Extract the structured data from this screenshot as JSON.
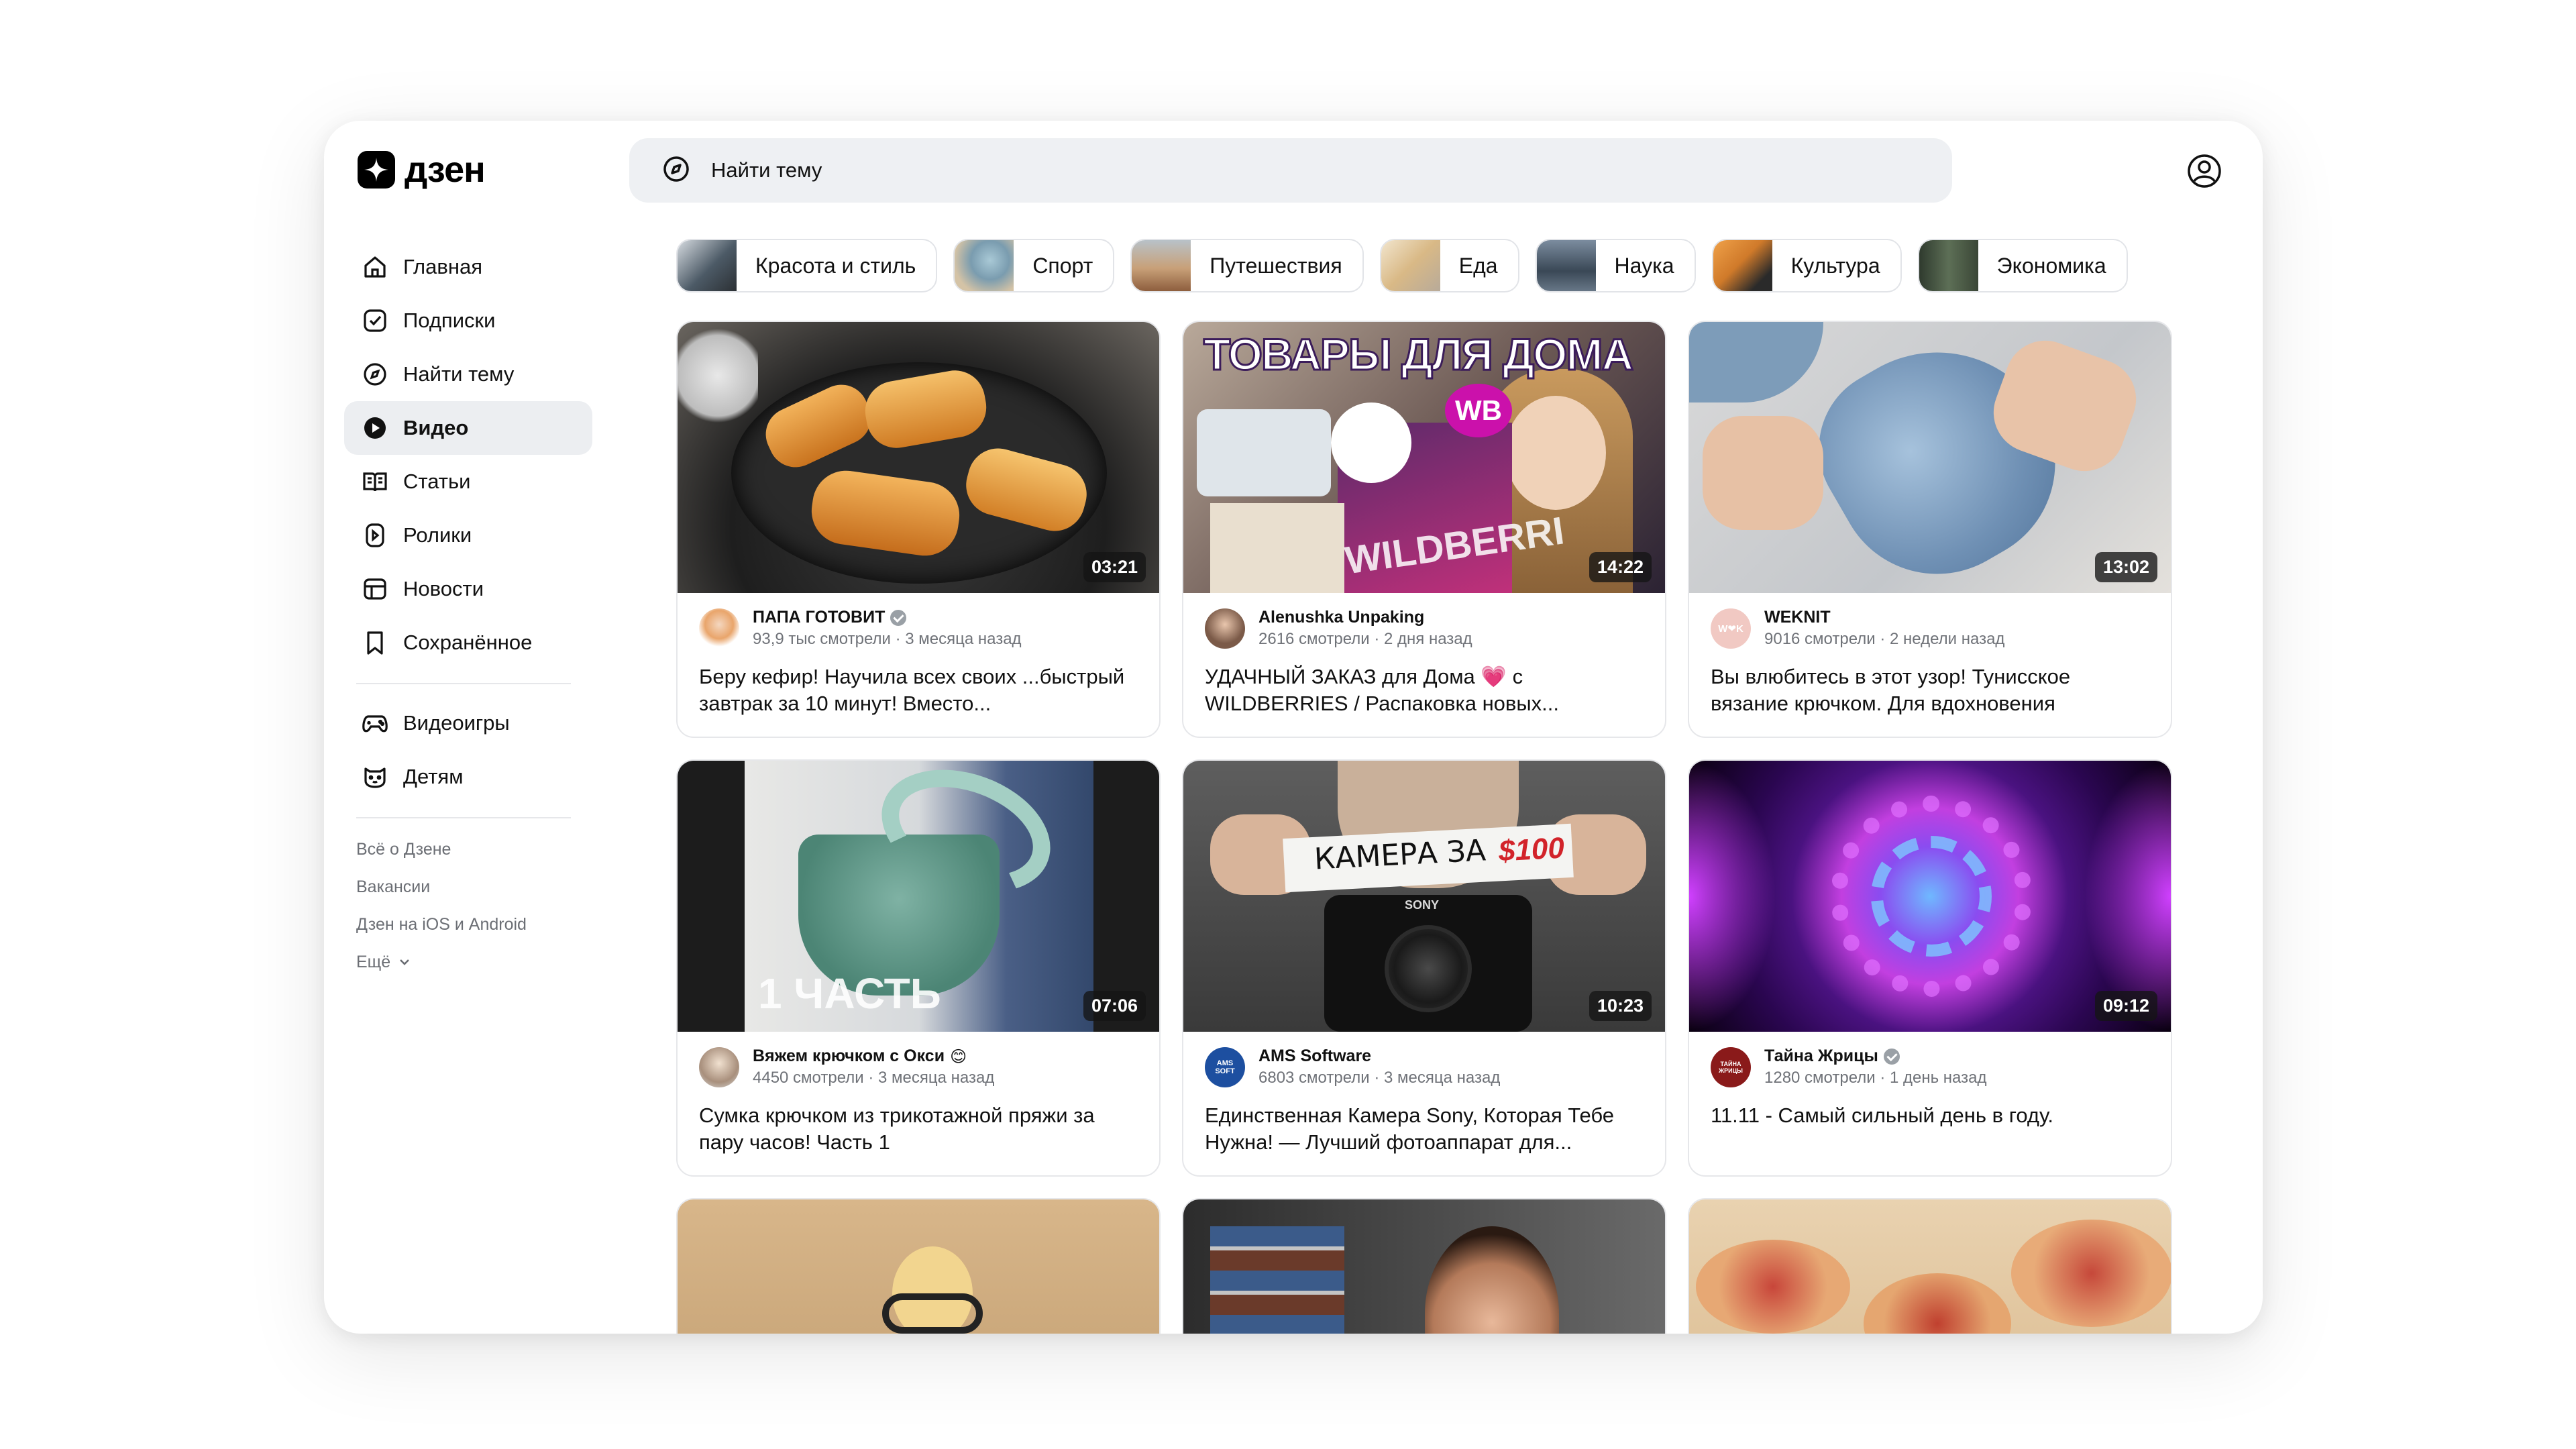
{
  "app": {
    "logo_text": "дзен"
  },
  "search": {
    "placeholder": "Найти тему"
  },
  "sidebar": {
    "items": [
      {
        "label": "Главная",
        "icon": "home-icon"
      },
      {
        "label": "Подписки",
        "icon": "subscriptions-icon"
      },
      {
        "label": "Найти тему",
        "icon": "search-topic-icon"
      },
      {
        "label": "Видео",
        "icon": "video-icon",
        "active": true
      },
      {
        "label": "Статьи",
        "icon": "articles-icon"
      },
      {
        "label": "Ролики",
        "icon": "shorts-icon"
      },
      {
        "label": "Новости",
        "icon": "news-icon"
      },
      {
        "label": "Сохранённое",
        "icon": "bookmark-icon"
      }
    ],
    "extra_items": [
      {
        "label": "Видеоигры",
        "icon": "gamepad-icon"
      },
      {
        "label": "Детям",
        "icon": "kids-icon"
      }
    ],
    "footer_links": [
      "Всё о Дзене",
      "Вакансии",
      "Дзен на iOS и Android"
    ],
    "more_label": "Ещё"
  },
  "chips": [
    {
      "label": "Красота и стиль",
      "color": "#5b6b78"
    },
    {
      "label": "Спорт",
      "color": "#8fb3c4"
    },
    {
      "label": "Путешествия",
      "color": "#c59b74"
    },
    {
      "label": "Еда",
      "color": "#d8b98b"
    },
    {
      "label": "Наука",
      "color": "#3c4a5a"
    },
    {
      "label": "Культура",
      "color": "#e0893a"
    },
    {
      "label": "Экономика",
      "color": "#4c5d4a"
    }
  ],
  "videos": [
    {
      "author": "ПАПА ГОТОВИТ",
      "verified": true,
      "stats": "93,9 тыс смотрели · 3 месяца назад",
      "title": "Беру кефир! Научила всех своих ...быстрый завтрак за 10 минут! Вместо...",
      "duration": "03:21"
    },
    {
      "author": "Alenushka Unpaking",
      "stats": "2616 смотрели · 2 дня назад",
      "title": "УДАЧНЫЙ ЗАКАЗ для Дома 💗 с WILDBERRIES / Распаковка новых...",
      "duration": "14:22",
      "overlay": "ТОВАРЫ ДЛЯ ДОМА",
      "overlay2": "WB",
      "overlay3": "WILDBERRI"
    },
    {
      "author": "WEKNIT",
      "stats": "9016 смотрели · 2 недели назад",
      "title": "Вы влюбитесь в этот узор! Тунисское вязание крючком. Для вдохновения",
      "duration": "13:02",
      "avatar_text": "W❤K"
    },
    {
      "author": "Вяжем крючком с Окси",
      "author_emoji": "😊",
      "stats": "4450 смотрели · 3 месяца назад",
      "title": "Сумка крючком из трикотажной пряжи за пару часов! Часть 1",
      "duration": "07:06",
      "overlay": "1 ЧАСТЬ"
    },
    {
      "author": "AMS Software",
      "stats": "6803 смотрели · 3 месяца назад",
      "title": "Единственная Камера Sony, Которая Тебе Нужна! — Лучший фотоаппарат для...",
      "duration": "10:23",
      "overlay": "КАМЕРА ЗА",
      "overlay2": "$100",
      "avatar_text": "AMS SOFT",
      "brand_text": "SONY"
    },
    {
      "author": "Тайна Жрицы",
      "verified": true,
      "stats": "1280 смотрели · 1 день назад",
      "title": "11.11 - Самый сильный день в году.",
      "duration": "09:12",
      "avatar_text": "ТАЙНА ЖРИЦЫ"
    },
    {
      "author": "",
      "stats": "",
      "title": "",
      "duration": ""
    },
    {
      "author": "",
      "stats": "",
      "title": "",
      "duration": ""
    },
    {
      "author": "",
      "stats": "",
      "title": "",
      "duration": ""
    }
  ],
  "colors": {
    "accent": "#000000",
    "active_bg": "#eceef1",
    "search_bg": "#eef0f3",
    "muted_text": "#6f7278"
  }
}
